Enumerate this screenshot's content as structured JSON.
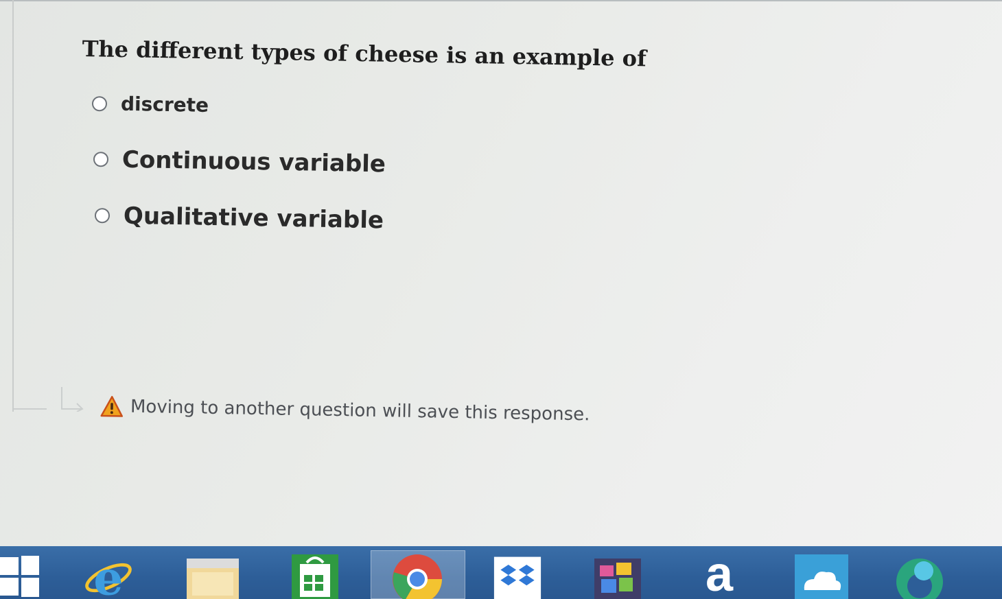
{
  "question": {
    "text": "The different types of cheese is an example of"
  },
  "options": [
    {
      "label": "discrete",
      "selected": false
    },
    {
      "label": "Continuous variable",
      "selected": false
    },
    {
      "label": "Qualitative variable",
      "selected": false
    }
  ],
  "notice": {
    "icon": "warning-icon",
    "text": "Moving to another question will save this response."
  },
  "taskbar": {
    "items": [
      {
        "icon": "windows-start-icon"
      },
      {
        "icon": "internet-explorer-icon"
      },
      {
        "icon": "file-explorer-icon"
      },
      {
        "icon": "windows-store-icon"
      },
      {
        "icon": "chrome-icon"
      },
      {
        "icon": "dropbox-icon"
      },
      {
        "icon": "photos-app-icon"
      },
      {
        "icon": "amazon-icon",
        "glyph": "a"
      },
      {
        "icon": "onedrive-icon"
      },
      {
        "icon": "edge-icon"
      }
    ]
  },
  "colors": {
    "question_text": "#1e1e1e",
    "option_text": "#2a2a2a",
    "notice_text": "#4c4f54",
    "warning": "#e0711e",
    "taskbar": "#2d5e98"
  }
}
